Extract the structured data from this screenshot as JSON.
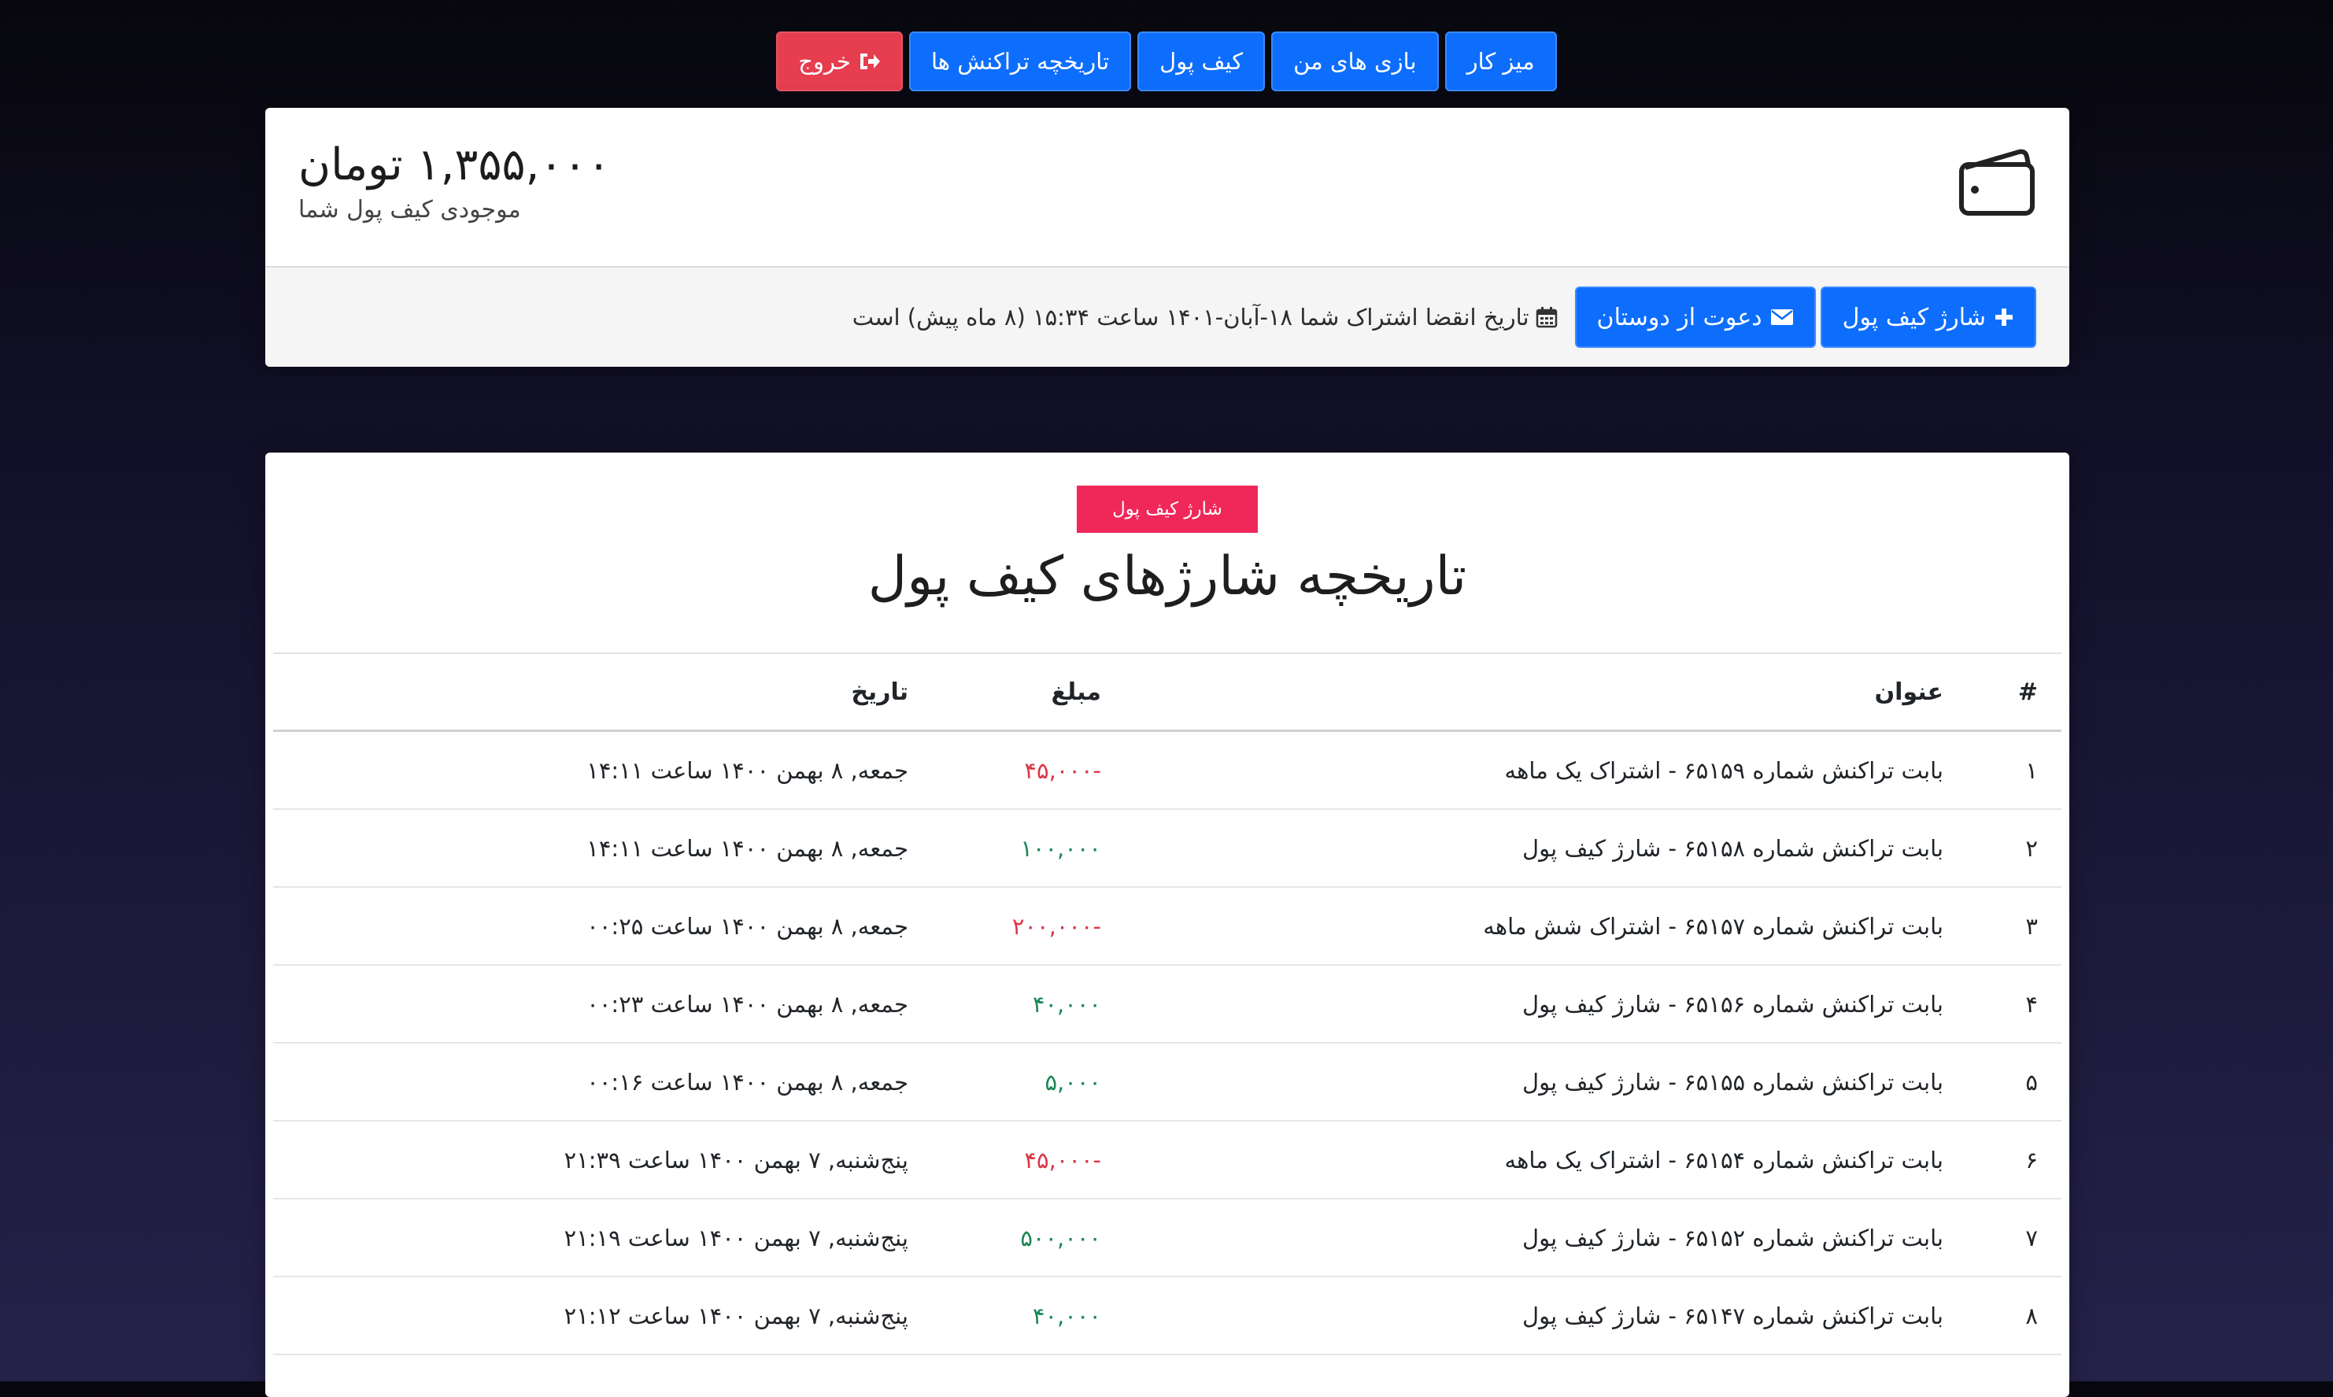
{
  "nav": {
    "dashboard": "میز کار",
    "my_games": "بازی های من",
    "wallet": "کیف پول",
    "transactions": "تاریخچه تراکنش ها",
    "logout": "خروج"
  },
  "wallet": {
    "amount": "۱,۳۵۵,۰۰۰ تومان",
    "subtitle": "موجودی کیف پول شما",
    "charge_button": "شارژ کیف پول",
    "invite_button": "دعوت از دوستان",
    "expiry_text": "تاریخ انقضا اشتراک شما ۱۸-آبان-۱۴۰۱ ساعت ۱۵:۳۴ (۸ ماه پیش) است"
  },
  "history": {
    "badge": "شارژ کیف پول",
    "title": "تاریخچه شارژهای کیف پول",
    "columns": {
      "num": "#",
      "title": "عنوان",
      "amount": "مبلغ",
      "date": "تاریخ"
    },
    "rows": [
      {
        "num": "۱",
        "title": "بابت تراکنش شماره ۶۵۱۵۹ - اشتراک یک ماهه",
        "amount": "-۴۵,۰۰۰",
        "date": "جمعه, ۸ بهمن ۱۴۰۰ ساعت ۱۴:۱۱"
      },
      {
        "num": "۲",
        "title": "بابت تراکنش شماره ۶۵۱۵۸ - شارژ کیف پول",
        "amount": "۱۰۰,۰۰۰",
        "date": "جمعه, ۸ بهمن ۱۴۰۰ ساعت ۱۴:۱۱"
      },
      {
        "num": "۳",
        "title": "بابت تراکنش شماره ۶۵۱۵۷ - اشتراک شش ماهه",
        "amount": "-۲۰۰,۰۰۰",
        "date": "جمعه, ۸ بهمن ۱۴۰۰ ساعت ۰۰:۲۵"
      },
      {
        "num": "۴",
        "title": "بابت تراکنش شماره ۶۵۱۵۶ - شارژ کیف پول",
        "amount": "۴۰,۰۰۰",
        "date": "جمعه, ۸ بهمن ۱۴۰۰ ساعت ۰۰:۲۳"
      },
      {
        "num": "۵",
        "title": "بابت تراکنش شماره ۶۵۱۵۵ - شارژ کیف پول",
        "amount": "۵,۰۰۰",
        "date": "جمعه, ۸ بهمن ۱۴۰۰ ساعت ۰۰:۱۶"
      },
      {
        "num": "۶",
        "title": "بابت تراکنش شماره ۶۵۱۵۴ - اشتراک یک ماهه",
        "amount": "-۴۵,۰۰۰",
        "date": "پنج‌شنبه, ۷ بهمن ۱۴۰۰ ساعت ۲۱:۳۹"
      },
      {
        "num": "۷",
        "title": "بابت تراکنش شماره ۶۵۱۵۲ - شارژ کیف پول",
        "amount": "۵۰۰,۰۰۰",
        "date": "پنج‌شنبه, ۷ بهمن ۱۴۰۰ ساعت ۲۱:۱۹"
      },
      {
        "num": "۸",
        "title": "بابت تراکنش شماره ۶۵۱۴۷ - شارژ کیف پول",
        "amount": "۴۰,۰۰۰",
        "date": "پنج‌شنبه, ۷ بهمن ۱۴۰۰ ساعت ۲۱:۱۲"
      }
    ]
  },
  "colors": {
    "primary": "#0d6efd",
    "danger": "#e63d4f",
    "badge": "#f0285a",
    "negative": "#dc3545",
    "positive": "#198754"
  },
  "icons": {
    "logout": "sign-out-icon",
    "charge": "plus-icon",
    "invite": "envelope-icon",
    "expiry": "calendar-icon",
    "wallet": "wallet-icon"
  }
}
